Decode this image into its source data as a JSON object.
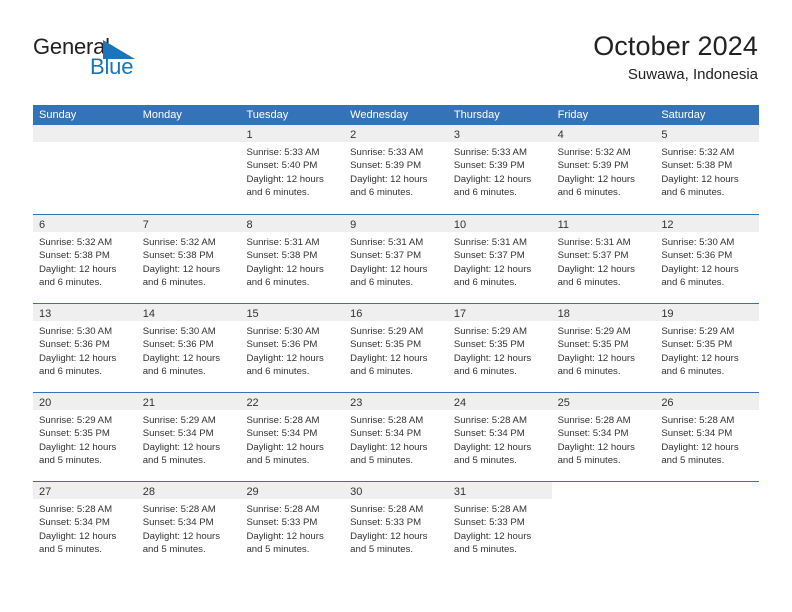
{
  "logo": {
    "primary_text": "General",
    "secondary_text": "Blue",
    "triangle_color": "#1b75bb",
    "primary_color": "#231f20",
    "secondary_color": "#1b75bb"
  },
  "header": {
    "month_title": "October 2024",
    "location": "Suwawa, Indonesia"
  },
  "theme": {
    "header_blue": "#3573b9",
    "date_band_gray": "#efefef",
    "text_color": "#333333"
  },
  "weekdays": [
    "Sunday",
    "Monday",
    "Tuesday",
    "Wednesday",
    "Thursday",
    "Friday",
    "Saturday"
  ],
  "weeks": [
    [
      {
        "date": "",
        "sunrise": "",
        "sunset": "",
        "daylight_line1": "",
        "daylight_line2": "",
        "empty": true
      },
      {
        "date": "",
        "sunrise": "",
        "sunset": "",
        "daylight_line1": "",
        "daylight_line2": "",
        "empty": true
      },
      {
        "date": "1",
        "sunrise": "Sunrise: 5:33 AM",
        "sunset": "Sunset: 5:40 PM",
        "daylight_line1": "Daylight: 12 hours",
        "daylight_line2": "and 6 minutes.",
        "empty": false
      },
      {
        "date": "2",
        "sunrise": "Sunrise: 5:33 AM",
        "sunset": "Sunset: 5:39 PM",
        "daylight_line1": "Daylight: 12 hours",
        "daylight_line2": "and 6 minutes.",
        "empty": false
      },
      {
        "date": "3",
        "sunrise": "Sunrise: 5:33 AM",
        "sunset": "Sunset: 5:39 PM",
        "daylight_line1": "Daylight: 12 hours",
        "daylight_line2": "and 6 minutes.",
        "empty": false
      },
      {
        "date": "4",
        "sunrise": "Sunrise: 5:32 AM",
        "sunset": "Sunset: 5:39 PM",
        "daylight_line1": "Daylight: 12 hours",
        "daylight_line2": "and 6 minutes.",
        "empty": false
      },
      {
        "date": "5",
        "sunrise": "Sunrise: 5:32 AM",
        "sunset": "Sunset: 5:38 PM",
        "daylight_line1": "Daylight: 12 hours",
        "daylight_line2": "and 6 minutes.",
        "empty": false
      }
    ],
    [
      {
        "date": "6",
        "sunrise": "Sunrise: 5:32 AM",
        "sunset": "Sunset: 5:38 PM",
        "daylight_line1": "Daylight: 12 hours",
        "daylight_line2": "and 6 minutes.",
        "empty": false
      },
      {
        "date": "7",
        "sunrise": "Sunrise: 5:32 AM",
        "sunset": "Sunset: 5:38 PM",
        "daylight_line1": "Daylight: 12 hours",
        "daylight_line2": "and 6 minutes.",
        "empty": false
      },
      {
        "date": "8",
        "sunrise": "Sunrise: 5:31 AM",
        "sunset": "Sunset: 5:38 PM",
        "daylight_line1": "Daylight: 12 hours",
        "daylight_line2": "and 6 minutes.",
        "empty": false
      },
      {
        "date": "9",
        "sunrise": "Sunrise: 5:31 AM",
        "sunset": "Sunset: 5:37 PM",
        "daylight_line1": "Daylight: 12 hours",
        "daylight_line2": "and 6 minutes.",
        "empty": false
      },
      {
        "date": "10",
        "sunrise": "Sunrise: 5:31 AM",
        "sunset": "Sunset: 5:37 PM",
        "daylight_line1": "Daylight: 12 hours",
        "daylight_line2": "and 6 minutes.",
        "empty": false
      },
      {
        "date": "11",
        "sunrise": "Sunrise: 5:31 AM",
        "sunset": "Sunset: 5:37 PM",
        "daylight_line1": "Daylight: 12 hours",
        "daylight_line2": "and 6 minutes.",
        "empty": false
      },
      {
        "date": "12",
        "sunrise": "Sunrise: 5:30 AM",
        "sunset": "Sunset: 5:36 PM",
        "daylight_line1": "Daylight: 12 hours",
        "daylight_line2": "and 6 minutes.",
        "empty": false
      }
    ],
    [
      {
        "date": "13",
        "sunrise": "Sunrise: 5:30 AM",
        "sunset": "Sunset: 5:36 PM",
        "daylight_line1": "Daylight: 12 hours",
        "daylight_line2": "and 6 minutes.",
        "empty": false
      },
      {
        "date": "14",
        "sunrise": "Sunrise: 5:30 AM",
        "sunset": "Sunset: 5:36 PM",
        "daylight_line1": "Daylight: 12 hours",
        "daylight_line2": "and 6 minutes.",
        "empty": false
      },
      {
        "date": "15",
        "sunrise": "Sunrise: 5:30 AM",
        "sunset": "Sunset: 5:36 PM",
        "daylight_line1": "Daylight: 12 hours",
        "daylight_line2": "and 6 minutes.",
        "empty": false
      },
      {
        "date": "16",
        "sunrise": "Sunrise: 5:29 AM",
        "sunset": "Sunset: 5:35 PM",
        "daylight_line1": "Daylight: 12 hours",
        "daylight_line2": "and 6 minutes.",
        "empty": false
      },
      {
        "date": "17",
        "sunrise": "Sunrise: 5:29 AM",
        "sunset": "Sunset: 5:35 PM",
        "daylight_line1": "Daylight: 12 hours",
        "daylight_line2": "and 6 minutes.",
        "empty": false
      },
      {
        "date": "18",
        "sunrise": "Sunrise: 5:29 AM",
        "sunset": "Sunset: 5:35 PM",
        "daylight_line1": "Daylight: 12 hours",
        "daylight_line2": "and 6 minutes.",
        "empty": false
      },
      {
        "date": "19",
        "sunrise": "Sunrise: 5:29 AM",
        "sunset": "Sunset: 5:35 PM",
        "daylight_line1": "Daylight: 12 hours",
        "daylight_line2": "and 6 minutes.",
        "empty": false
      }
    ],
    [
      {
        "date": "20",
        "sunrise": "Sunrise: 5:29 AM",
        "sunset": "Sunset: 5:35 PM",
        "daylight_line1": "Daylight: 12 hours",
        "daylight_line2": "and 5 minutes.",
        "empty": false
      },
      {
        "date": "21",
        "sunrise": "Sunrise: 5:29 AM",
        "sunset": "Sunset: 5:34 PM",
        "daylight_line1": "Daylight: 12 hours",
        "daylight_line2": "and 5 minutes.",
        "empty": false
      },
      {
        "date": "22",
        "sunrise": "Sunrise: 5:28 AM",
        "sunset": "Sunset: 5:34 PM",
        "daylight_line1": "Daylight: 12 hours",
        "daylight_line2": "and 5 minutes.",
        "empty": false
      },
      {
        "date": "23",
        "sunrise": "Sunrise: 5:28 AM",
        "sunset": "Sunset: 5:34 PM",
        "daylight_line1": "Daylight: 12 hours",
        "daylight_line2": "and 5 minutes.",
        "empty": false
      },
      {
        "date": "24",
        "sunrise": "Sunrise: 5:28 AM",
        "sunset": "Sunset: 5:34 PM",
        "daylight_line1": "Daylight: 12 hours",
        "daylight_line2": "and 5 minutes.",
        "empty": false
      },
      {
        "date": "25",
        "sunrise": "Sunrise: 5:28 AM",
        "sunset": "Sunset: 5:34 PM",
        "daylight_line1": "Daylight: 12 hours",
        "daylight_line2": "and 5 minutes.",
        "empty": false
      },
      {
        "date": "26",
        "sunrise": "Sunrise: 5:28 AM",
        "sunset": "Sunset: 5:34 PM",
        "daylight_line1": "Daylight: 12 hours",
        "daylight_line2": "and 5 minutes.",
        "empty": false
      }
    ],
    [
      {
        "date": "27",
        "sunrise": "Sunrise: 5:28 AM",
        "sunset": "Sunset: 5:34 PM",
        "daylight_line1": "Daylight: 12 hours",
        "daylight_line2": "and 5 minutes.",
        "empty": false
      },
      {
        "date": "28",
        "sunrise": "Sunrise: 5:28 AM",
        "sunset": "Sunset: 5:34 PM",
        "daylight_line1": "Daylight: 12 hours",
        "daylight_line2": "and 5 minutes.",
        "empty": false
      },
      {
        "date": "29",
        "sunrise": "Sunrise: 5:28 AM",
        "sunset": "Sunset: 5:33 PM",
        "daylight_line1": "Daylight: 12 hours",
        "daylight_line2": "and 5 minutes.",
        "empty": false
      },
      {
        "date": "30",
        "sunrise": "Sunrise: 5:28 AM",
        "sunset": "Sunset: 5:33 PM",
        "daylight_line1": "Daylight: 12 hours",
        "daylight_line2": "and 5 minutes.",
        "empty": false
      },
      {
        "date": "31",
        "sunrise": "Sunrise: 5:28 AM",
        "sunset": "Sunset: 5:33 PM",
        "daylight_line1": "Daylight: 12 hours",
        "daylight_line2": "and 5 minutes.",
        "empty": false
      },
      {
        "date": "",
        "sunrise": "",
        "sunset": "",
        "daylight_line1": "",
        "daylight_line2": "",
        "empty": true,
        "blank": true
      },
      {
        "date": "",
        "sunrise": "",
        "sunset": "",
        "daylight_line1": "",
        "daylight_line2": "",
        "empty": true,
        "blank": true
      }
    ]
  ]
}
